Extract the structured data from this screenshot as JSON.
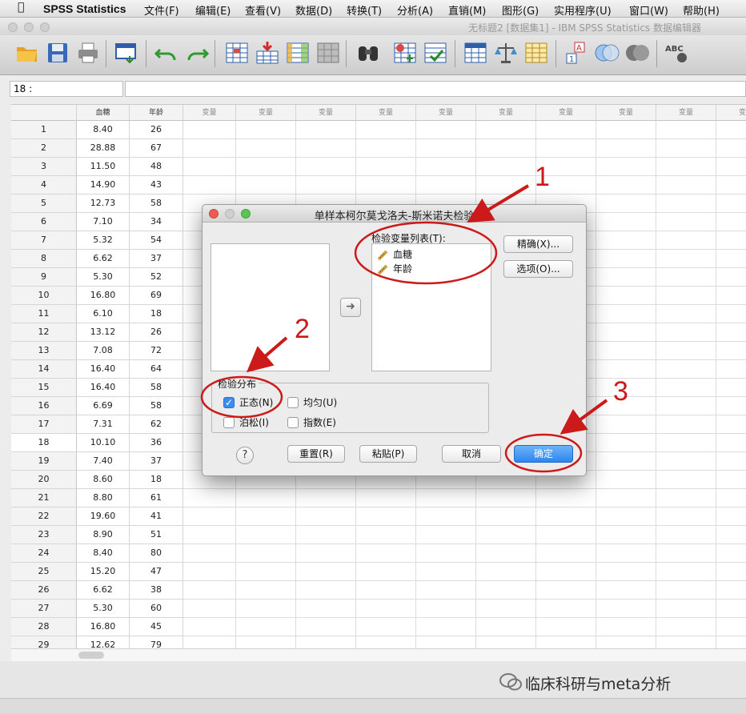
{
  "menubar": {
    "app_name": "SPSS Statistics",
    "items": [
      "文件(F)",
      "编辑(E)",
      "查看(V)",
      "数据(D)",
      "转换(T)",
      "分析(A)",
      "直销(M)",
      "图形(G)",
      "实用程序(U)",
      "窗口(W)",
      "帮助(H)"
    ]
  },
  "window": {
    "title": "无标题2 [数据集1] - IBM SPSS Statistics 数据编辑器"
  },
  "cell_editor": {
    "reference": "18 :",
    "value": ""
  },
  "grid": {
    "columns": [
      "血糖",
      "年龄"
    ],
    "empty_var_label": "变量",
    "active_row": 18,
    "rows": [
      {
        "n": "1",
        "glucose": "8.40",
        "age": "26"
      },
      {
        "n": "2",
        "glucose": "28.88",
        "age": "67"
      },
      {
        "n": "3",
        "glucose": "11.50",
        "age": "48"
      },
      {
        "n": "4",
        "glucose": "14.90",
        "age": "43"
      },
      {
        "n": "5",
        "glucose": "12.73",
        "age": "58"
      },
      {
        "n": "6",
        "glucose": "7.10",
        "age": "34"
      },
      {
        "n": "7",
        "glucose": "5.32",
        "age": "54"
      },
      {
        "n": "8",
        "glucose": "6.62",
        "age": "37"
      },
      {
        "n": "9",
        "glucose": "5.30",
        "age": "52"
      },
      {
        "n": "10",
        "glucose": "16.80",
        "age": "69"
      },
      {
        "n": "11",
        "glucose": "6.10",
        "age": "18"
      },
      {
        "n": "12",
        "glucose": "13.12",
        "age": "26"
      },
      {
        "n": "13",
        "glucose": "7.08",
        "age": "72"
      },
      {
        "n": "14",
        "glucose": "16.40",
        "age": "64"
      },
      {
        "n": "15",
        "glucose": "16.40",
        "age": "58"
      },
      {
        "n": "16",
        "glucose": "6.69",
        "age": "58"
      },
      {
        "n": "17",
        "glucose": "7.31",
        "age": "62"
      },
      {
        "n": "18",
        "glucose": "10.10",
        "age": "36"
      },
      {
        "n": "19",
        "glucose": "7.40",
        "age": "37"
      },
      {
        "n": "20",
        "glucose": "8.60",
        "age": "18"
      },
      {
        "n": "21",
        "glucose": "8.80",
        "age": "61"
      },
      {
        "n": "22",
        "glucose": "19.60",
        "age": "41"
      },
      {
        "n": "23",
        "glucose": "8.90",
        "age": "51"
      },
      {
        "n": "24",
        "glucose": "8.40",
        "age": "80"
      },
      {
        "n": "25",
        "glucose": "15.20",
        "age": "47"
      },
      {
        "n": "26",
        "glucose": "6.62",
        "age": "38"
      },
      {
        "n": "27",
        "glucose": "5.30",
        "age": "60"
      },
      {
        "n": "28",
        "glucose": "16.80",
        "age": "45"
      },
      {
        "n": "29",
        "glucose": "12.62",
        "age": "79"
      }
    ]
  },
  "dialog": {
    "title": "单样本柯尔莫戈洛夫-斯米诺夫检验",
    "test_list_label": "检验变量列表(T):",
    "test_variables": [
      "血糖",
      "年龄"
    ],
    "exact_button": "精确(X)...",
    "options_button": "选项(O)...",
    "distribution_group": "检验分布",
    "distributions": [
      {
        "label": "正态(N)",
        "checked": true
      },
      {
        "label": "均匀(U)",
        "checked": false
      },
      {
        "label": "泊松(I)",
        "checked": false
      },
      {
        "label": "指数(E)",
        "checked": false
      }
    ],
    "help_label": "?",
    "reset_button": "重置(R)",
    "paste_button": "粘贴(P)",
    "cancel_button": "取消",
    "ok_button": "确定"
  },
  "annotations": {
    "labels": [
      "1",
      "2",
      "3"
    ],
    "color": "#cc1a1a"
  },
  "watermark": {
    "text": "临床科研与meta分析"
  },
  "colors": {
    "primary_button": "#2f86ee",
    "checkbox_on": "#3c8df0"
  }
}
